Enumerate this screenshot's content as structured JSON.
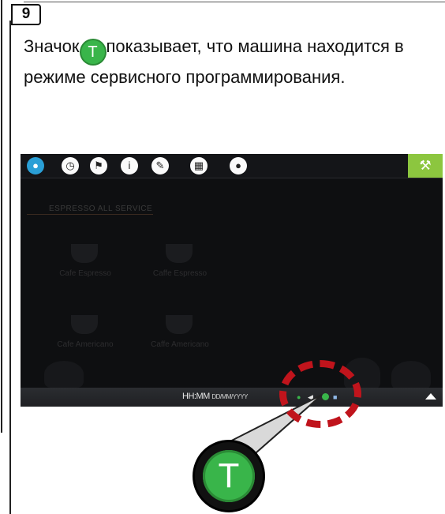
{
  "step": {
    "number": "9"
  },
  "description": {
    "before": "Значок",
    "icon_letter": "T",
    "after": "показывает, что машина находится в режиме сервисного программирования."
  },
  "screen": {
    "topbar_icons": [
      "drop-icon",
      "clock-icon",
      "flag-icon",
      "info-icon",
      "pencil-icon",
      "calendar-icon",
      "user-icon"
    ],
    "wrench_icon": "wrench-icon",
    "menu_title": "ESPRESSO ALL SERVICE",
    "tiles": [
      {
        "label": "Cafe Espresso"
      },
      {
        "label": "Caffe Espresso"
      },
      {
        "label": "Cafe Americano"
      },
      {
        "label": "Caffe Americano"
      }
    ],
    "status": {
      "time": "HH:MM",
      "date": "DD/MM/YYYY",
      "icons": [
        "wifi-icon",
        "speaker-icon",
        "service-mode-icon",
        "card-icon"
      ]
    }
  },
  "zoom": {
    "letter": "T"
  },
  "colors": {
    "service_green": "#39b54a",
    "wrench_green": "#8cc63f",
    "highlight_red": "#c0141c",
    "water_blue": "#2a9fd6"
  }
}
